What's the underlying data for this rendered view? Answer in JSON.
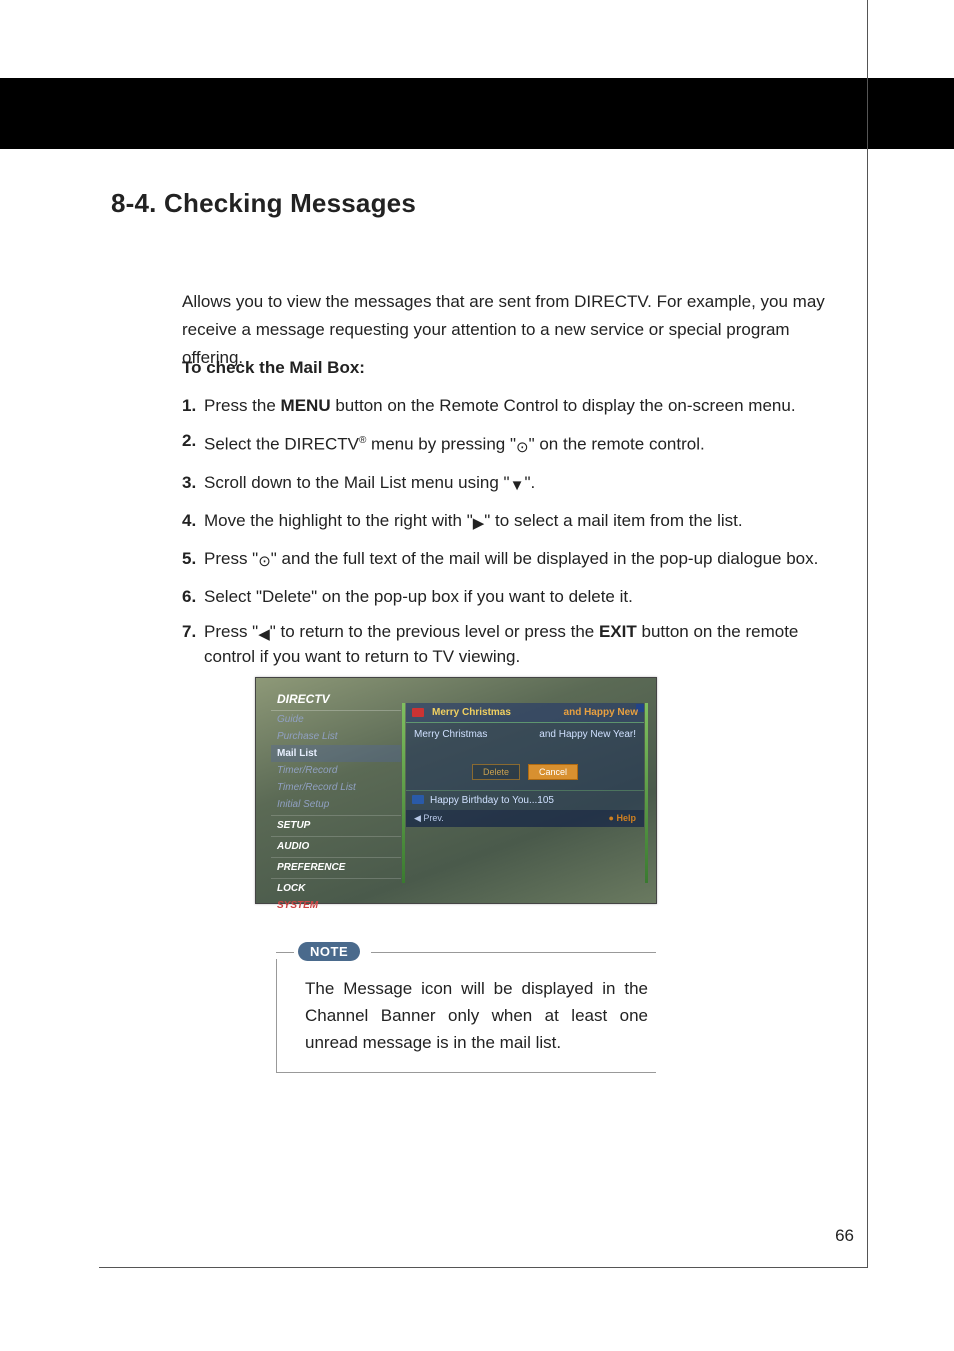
{
  "section_title": "8-4. Checking Messages",
  "intro": "Allows you to view the messages that are sent from DIRECTV.  For example, you may receive a message requesting your attention to a new service or special program offering.",
  "subhead": "To check the Mail Box:",
  "steps": [
    {
      "n": "1.",
      "pre": "Press the ",
      "bold1": "MENU",
      "post": " button on the Remote Control to display the on-screen menu."
    },
    {
      "n": "2.",
      "pre": "Select the DIRECTV",
      "sup": "®",
      "mid": " menu by pressing \"",
      "glyph": "⊙",
      "post": "\" on the remote control."
    },
    {
      "n": "3.",
      "pre": "Scroll down to the Mail List menu using \"",
      "glyph": "▼",
      "post": "\"."
    },
    {
      "n": "4.",
      "pre": "Move the highlight to the right with \"",
      "glyph": "▶",
      "post": "\" to select a mail item from the list."
    },
    {
      "n": "5.",
      "pre": "Press \"",
      "glyph": "⊙",
      "post": "\" and the full text of the mail will be displayed in the pop-up dialogue box."
    },
    {
      "n": "6.",
      "pre": "Select \"Delete\" on the pop-up box if you want to delete it."
    },
    {
      "n": "7.",
      "pre": "Press \"",
      "glyph": "◀",
      "mid2": "\" to return to the previous level or press the ",
      "bold1": "EXIT",
      "post": " button on the remote control if you want to return to TV viewing."
    }
  ],
  "screenshot": {
    "brand": "DIRECTV",
    "sidebar": {
      "items": [
        {
          "label": "Guide",
          "cls": ""
        },
        {
          "label": "Purchase List",
          "cls": ""
        },
        {
          "label": "Mail List",
          "cls": "sel"
        },
        {
          "label": "Timer/Record",
          "cls": ""
        },
        {
          "label": "Timer/Record List",
          "cls": ""
        },
        {
          "label": "Initial Setup",
          "cls": ""
        },
        {
          "label": "SETUP",
          "cls": "cat"
        },
        {
          "label": "AUDIO",
          "cls": "cat"
        },
        {
          "label": "PREFERENCE",
          "cls": "cat"
        },
        {
          "label": "LOCK",
          "cls": "cat"
        },
        {
          "label": "SYSTEM",
          "cls": "sys"
        }
      ]
    },
    "mail_header_t1": "Merry Christmas",
    "mail_header_t2": "and Happy New",
    "mail_body_line_a": "Merry Christmas",
    "mail_body_line_b": "and Happy New Year!",
    "btn_delete": "Delete",
    "btn_cancel": "Cancel",
    "mail2": "Happy Birthday to You...105",
    "footer_prev": "◀ Prev.",
    "footer_help": "● Help"
  },
  "note_label": "NOTE",
  "note_body": "The Message icon will be displayed in the Channel Banner only when at least one unread message is in the mail list.",
  "page_number": "66"
}
